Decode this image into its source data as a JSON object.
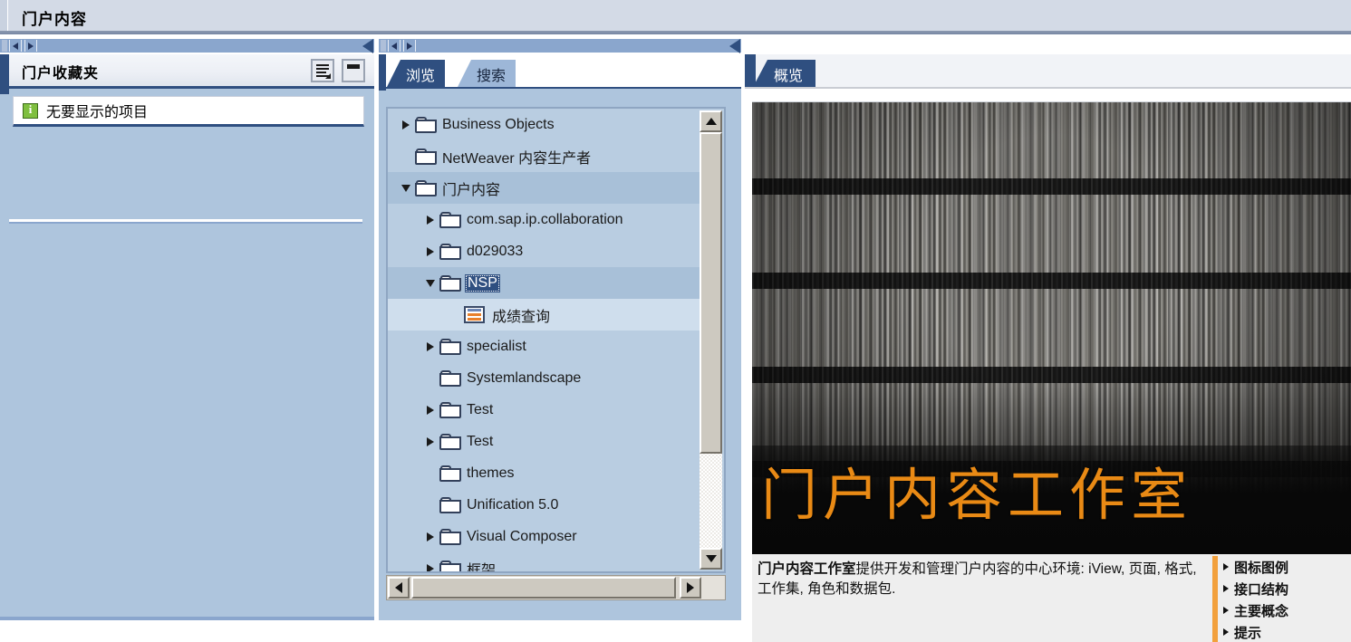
{
  "window": {
    "title": "门户内容"
  },
  "navbars": {
    "prev_icon": "triangle-left-icon",
    "next_icon": "triangle-right-icon",
    "collapse_icon": "collapse-left-arrow-icon"
  },
  "left_panel": {
    "header": "门户收藏夹",
    "options_icon": "list-options-icon",
    "minimize_icon": "minimize-icon",
    "items": [
      {
        "icon": "info-icon",
        "label": "无要显示的项目"
      }
    ]
  },
  "middle_panel": {
    "tabs": [
      {
        "label": "浏览",
        "active": true
      },
      {
        "label": "搜索",
        "active": false
      }
    ],
    "tree": [
      {
        "label": "Business Objects",
        "indent": 0,
        "twist": "right",
        "icon": "folder-icon",
        "row": "plain",
        "selected": false
      },
      {
        "label": "NetWeaver 内容生产者",
        "indent": 0,
        "twist": "none",
        "icon": "folder-icon",
        "row": "plain",
        "selected": false
      },
      {
        "label": "门户内容",
        "indent": 0,
        "twist": "down",
        "icon": "folder-icon",
        "row": "hl-med",
        "selected": false
      },
      {
        "label": "com.sap.ip.collaboration",
        "indent": 1,
        "twist": "right",
        "icon": "folder-icon",
        "row": "plain",
        "selected": false
      },
      {
        "label": "d029033",
        "indent": 1,
        "twist": "right",
        "icon": "folder-icon",
        "row": "plain",
        "selected": false
      },
      {
        "label": "NSP",
        "indent": 1,
        "twist": "down",
        "icon": "folder-icon",
        "row": "hl-med",
        "selected": true
      },
      {
        "label": "成绩查询",
        "indent": 2,
        "twist": "none",
        "icon": "iview-icon",
        "row": "hl-pale",
        "selected": false
      },
      {
        "label": "specialist",
        "indent": 1,
        "twist": "right",
        "icon": "folder-icon",
        "row": "plain",
        "selected": false
      },
      {
        "label": "Systemlandscape",
        "indent": 1,
        "twist": "none",
        "icon": "folder-icon",
        "row": "plain",
        "selected": false
      },
      {
        "label": "Test",
        "indent": 1,
        "twist": "right",
        "icon": "folder-icon",
        "row": "plain",
        "selected": false
      },
      {
        "label": "Test",
        "indent": 1,
        "twist": "right",
        "icon": "folder-icon",
        "row": "plain",
        "selected": false
      },
      {
        "label": "themes",
        "indent": 1,
        "twist": "none",
        "icon": "folder-icon",
        "row": "plain",
        "selected": false
      },
      {
        "label": "Unification 5.0",
        "indent": 1,
        "twist": "none",
        "icon": "folder-icon",
        "row": "plain",
        "selected": false
      },
      {
        "label": "Visual Composer",
        "indent": 1,
        "twist": "right",
        "icon": "folder-icon",
        "row": "plain",
        "selected": false
      },
      {
        "label": "框架",
        "indent": 1,
        "twist": "right",
        "icon": "folder-icon",
        "row": "plain",
        "selected": false
      }
    ],
    "scrollbar": {
      "up_icon": "scroll-up-icon",
      "down_icon": "scroll-down-icon",
      "left_icon": "scroll-left-icon",
      "right_icon": "scroll-right-icon"
    }
  },
  "right_panel": {
    "tabs": [
      {
        "label": "概览",
        "active": true
      }
    ],
    "hero": {
      "title": "门户内容工作室",
      "title_color": "#e98a15",
      "image": "bookshelf-photo"
    },
    "description": {
      "bold_part": "门户内容工作室",
      "rest": "提供开发和管理门户内容的中心环境: iView, 页面, 格式, 工作集, 角色和数据包."
    },
    "links": [
      {
        "label": "图标图例"
      },
      {
        "label": "接口结构"
      },
      {
        "label": "主要概念"
      },
      {
        "label": "提示"
      }
    ],
    "accent_color": "#f2a03c"
  }
}
